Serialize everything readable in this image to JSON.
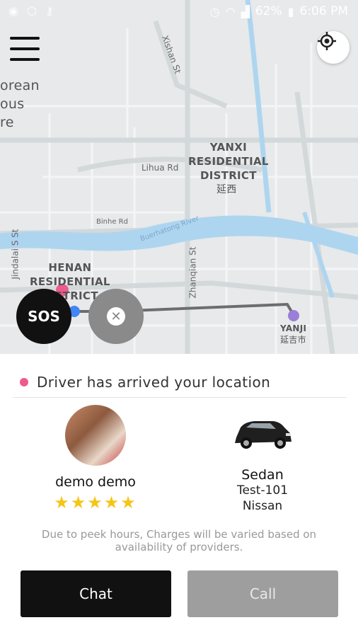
{
  "status_bar": {
    "left_icons": [
      "location-icon",
      "app-icon",
      "key-icon"
    ],
    "battery": "62%",
    "time": "6:06 PM"
  },
  "map": {
    "districts": [
      {
        "name": "YANXI\nRESIDENTIAL\nDISTRICT",
        "native": "延西"
      },
      {
        "name": "HENAN\nRESIDENTIAL\nDISTRICT",
        "native": ""
      },
      {
        "name": "YANJI",
        "native": "延吉市"
      }
    ],
    "partial_label": "orean\nous\nre",
    "roads": [
      "Xishan St",
      "Lihua Rd",
      "Binhe Rd",
      "Jindalai S St",
      "Zhanqian St",
      "Buerhatong River"
    ],
    "colors": {
      "water": "#aed5f0",
      "road": "#d7dbdd",
      "route": "#6d6d6d",
      "pickup": "#9b7ed8",
      "driver": "#ee5b8b"
    }
  },
  "sos": {
    "label": "SOS"
  },
  "trip": {
    "status_text": "Driver has arrived your location",
    "driver": {
      "name": "demo demo",
      "rating": 5,
      "stars": "★★★★★"
    },
    "vehicle": {
      "type": "Sedan",
      "plate": "Test-101",
      "make": "Nissan"
    },
    "note": "Due to peek hours, Charges will be varied based on availability of providers."
  },
  "actions": {
    "chat": "Chat",
    "call": "Call"
  }
}
